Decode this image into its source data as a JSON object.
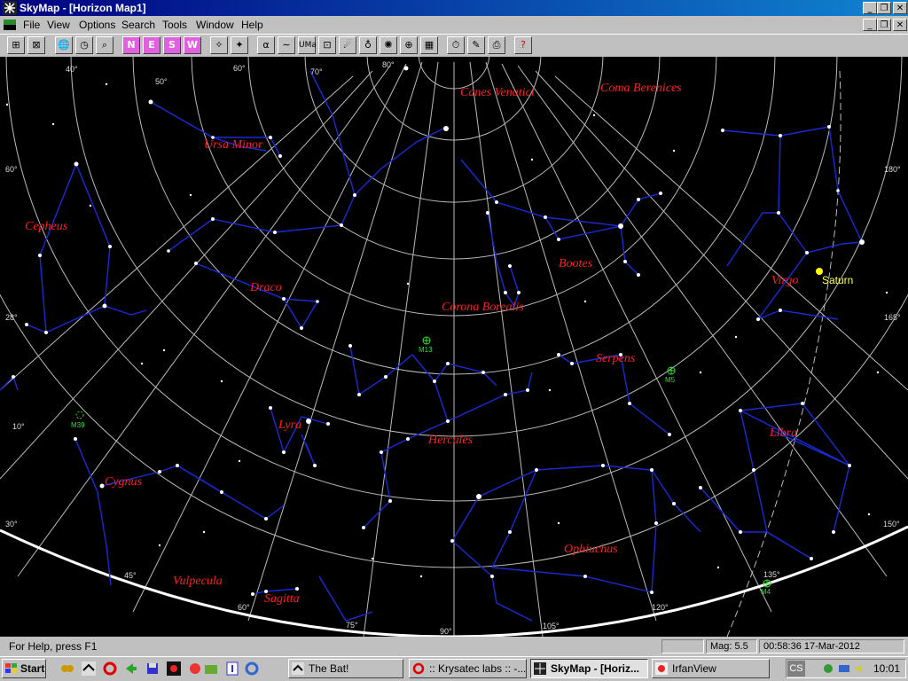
{
  "window": {
    "title": "SkyMap - [Horizon Map1]",
    "min_glyph": "_",
    "restore_glyph": "❐",
    "close_glyph": "✕"
  },
  "menu": {
    "items": [
      "File",
      "View",
      "Options",
      "Search",
      "Tools",
      "Window",
      "Help"
    ]
  },
  "toolbar": {
    "dir_buttons": [
      "N",
      "E",
      "S",
      "W"
    ],
    "label_buttons": [
      "α",
      "UMa"
    ]
  },
  "map": {
    "constellations": [
      "Canes Venatici",
      "Coma Berenices",
      "Ursa Minor",
      "Cepheus",
      "Draco",
      "Corona Borealis",
      "Bootes",
      "Virgo",
      "Serpens",
      "Lyra",
      "Hercules",
      "Libra",
      "Cygnus",
      "Ophiuchus",
      "Vulpecula",
      "Sagitta"
    ],
    "planets": [
      "Saturn"
    ],
    "objects": [
      "M13",
      "M5",
      "M39",
      "M4"
    ],
    "alt_labels": [
      "80°",
      "60°",
      "40°",
      "50°",
      "70°",
      "60°",
      "28°",
      "10°",
      "30°",
      "45°",
      "60°",
      "75°",
      "90°",
      "105°",
      "120°",
      "135°",
      "150°",
      "165°",
      "180°"
    ],
    "colors": {
      "background": "#000000",
      "constellation_lines": "#1a2bd6",
      "grid": "#bbbbbb",
      "names": "#ff2020",
      "planet": "#ffff00",
      "deep_sky": "#33dd33"
    }
  },
  "status": {
    "help": "For Help, press F1",
    "mag": "Mag: 5.5",
    "datetime": "00:58:36 17-Mar-2012"
  },
  "taskbar": {
    "start": "Start",
    "tasks": [
      "The Bat!",
      ":: Krysatec labs :: -...",
      "SkyMap - [Horiz...",
      "IrfanView"
    ],
    "cs": "CS",
    "clock": "10:01"
  }
}
